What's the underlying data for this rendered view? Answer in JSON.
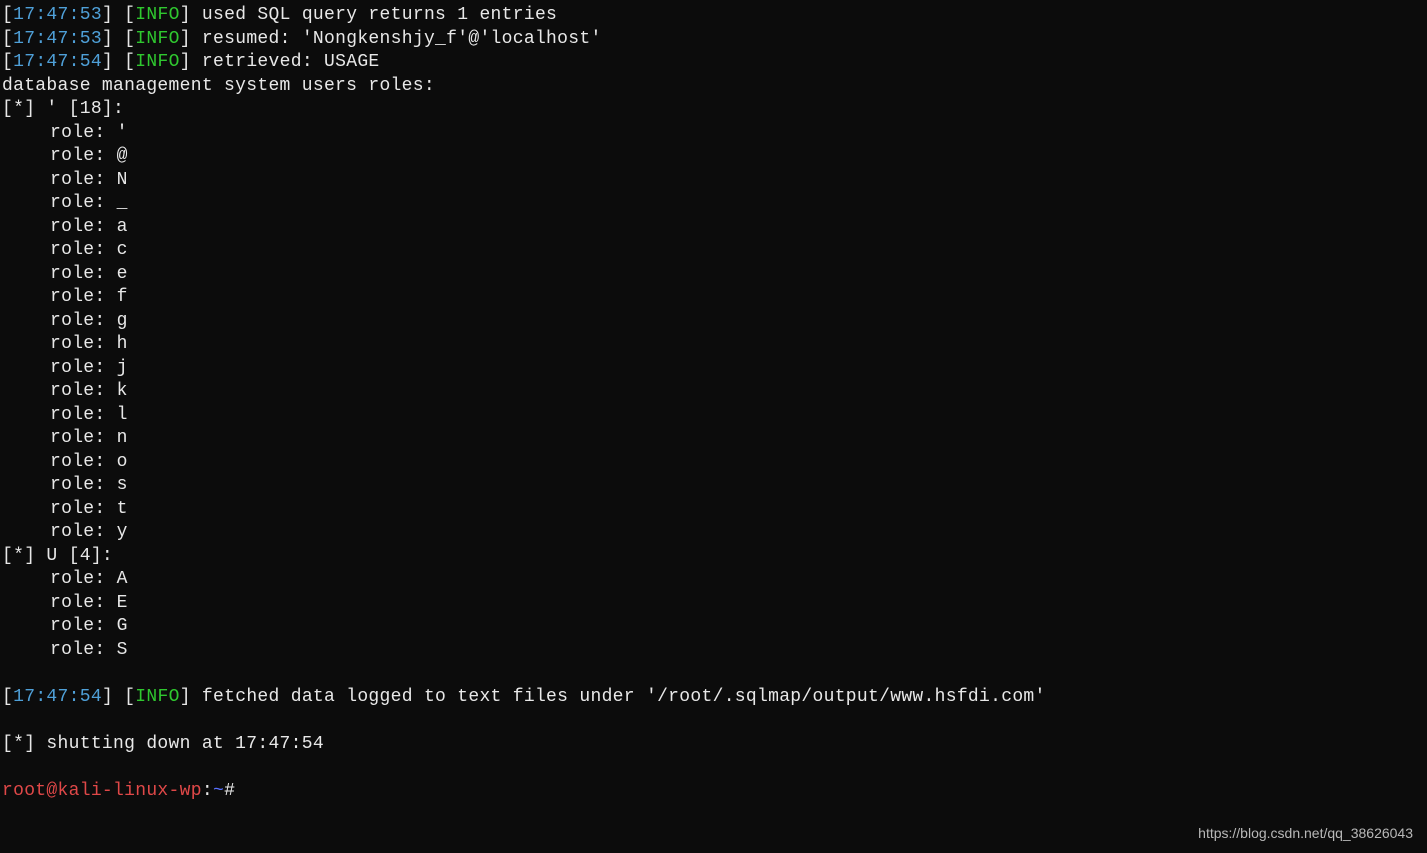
{
  "logs": [
    {
      "ts": "17:47:53",
      "level": "INFO",
      "msg": "used SQL query returns 1 entries"
    },
    {
      "ts": "17:47:53",
      "level": "INFO",
      "msg": "resumed: 'Nongkenshjy_f'@'localhost'"
    },
    {
      "ts": "17:47:54",
      "level": "INFO",
      "msg": "retrieved: USAGE"
    }
  ],
  "roles_header": "database management system users roles:",
  "group1": {
    "header": "[*] ' [18]:",
    "roles": [
      "'",
      "@",
      "N",
      "_",
      "a",
      "c",
      "e",
      "f",
      "g",
      "h",
      "j",
      "k",
      "l",
      "n",
      "o",
      "s",
      "t",
      "y"
    ]
  },
  "group2": {
    "header": "[*] U [4]:",
    "roles": [
      "A",
      "E",
      "G",
      "S"
    ]
  },
  "footer_log": {
    "ts": "17:47:54",
    "level": "INFO",
    "msg": "fetched data logged to text files under '/root/.sqlmap/output/www.hsfdi.com'"
  },
  "shutdown": "[*] shutting down at 17:47:54",
  "prompt": {
    "userhost": "root@kali-linux-wp",
    "sep": ":",
    "path": "~",
    "tail": "# "
  },
  "role_prefix": "role: ",
  "watermark": "https://blog.csdn.net/qq_38626043"
}
